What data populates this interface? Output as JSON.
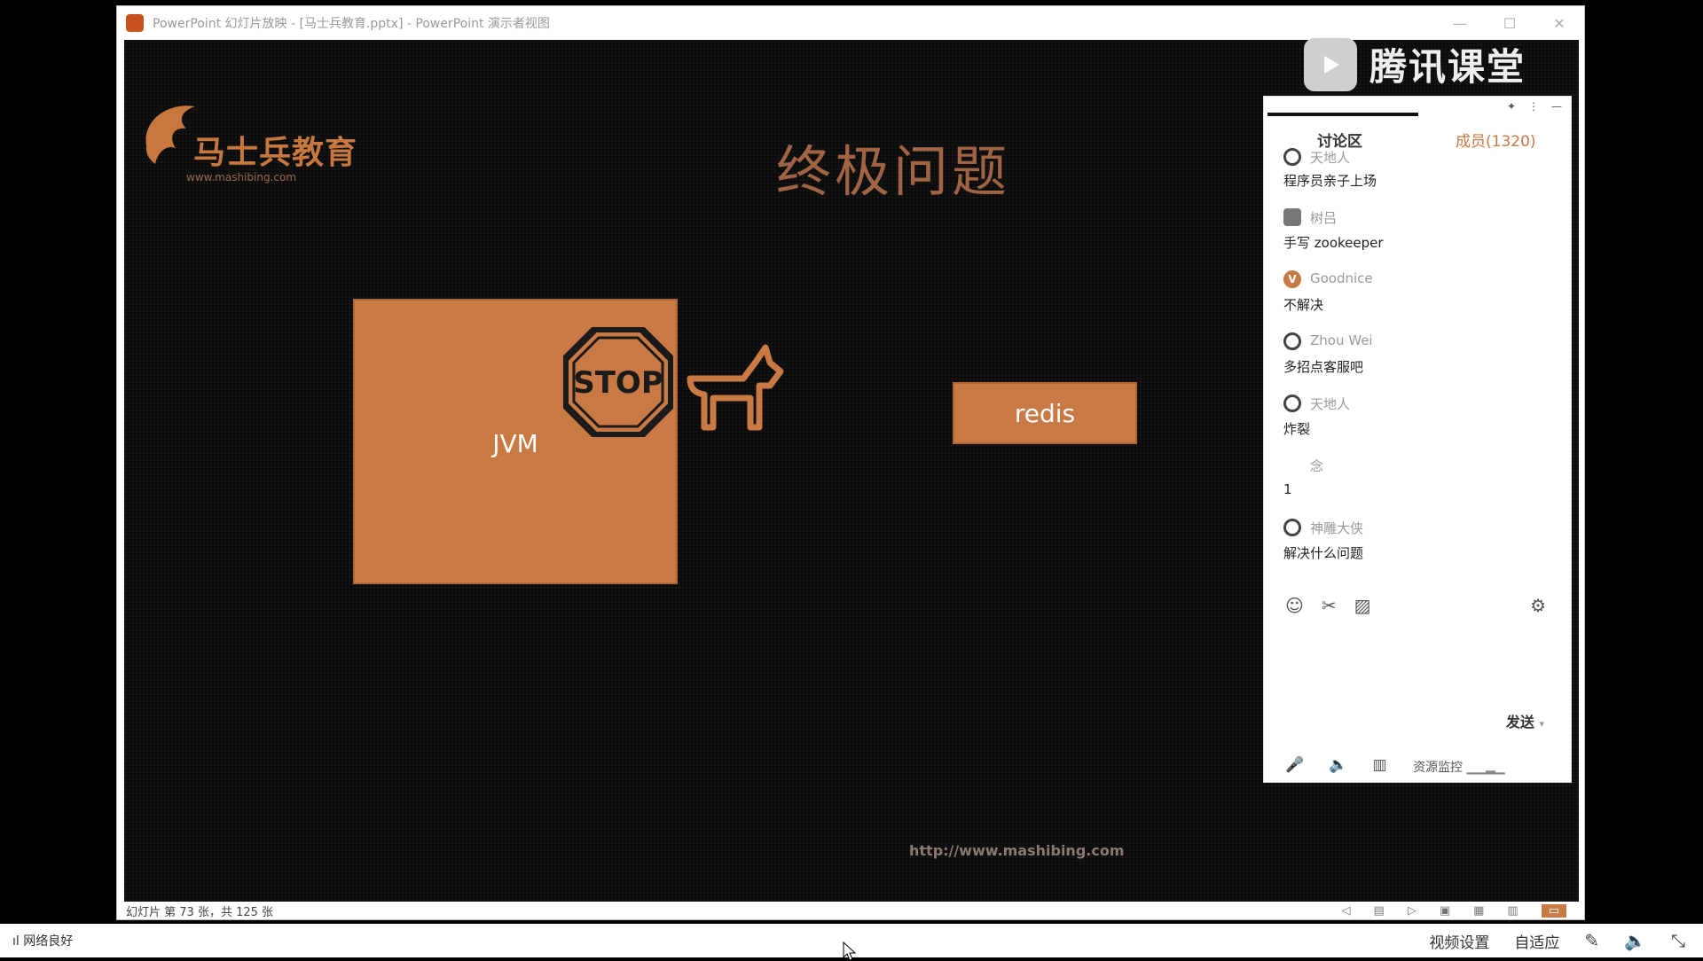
{
  "window": {
    "title": "PowerPoint 幻灯片放映 - [马士兵教育.pptx] - PowerPoint 演示者视图",
    "min": "—",
    "max": "☐",
    "close": "✕"
  },
  "slide": {
    "logo_text": "马士兵教育",
    "logo_url": "www.mashibing.com",
    "title": "终极问题",
    "jvm_label": "JVM",
    "stop_text": "STOP",
    "redis_label": "redis",
    "footer_url": "http://www.mashibing.com"
  },
  "statusbar": {
    "slide_info": "幻灯片 第 73 张，共 125 张"
  },
  "tencent": {
    "brand": "腾讯课堂"
  },
  "chat": {
    "tab_discuss": "讨论区",
    "tab_members": "成员(1320)",
    "messages": [
      {
        "user": "天地人",
        "text": "程序员亲子上场"
      },
      {
        "user": "树吕",
        "text": "手写 zookeeper"
      },
      {
        "user": "Goodnice",
        "text": "不解决"
      },
      {
        "user": "Zhou Wei",
        "text": "多招点客服吧"
      },
      {
        "user": "天地人",
        "text": "炸裂"
      },
      {
        "user": "念",
        "text": "1"
      },
      {
        "user": "神雕大侠",
        "text": "解决什么问题"
      }
    ],
    "send_label": "发送",
    "resource_monitor": "资源监控"
  },
  "bottom": {
    "network": "网络良好",
    "video_settings": "视频设置",
    "adaptive": "自适应"
  },
  "colors": {
    "accent": "#c97943",
    "background": "#0c0c0c"
  }
}
